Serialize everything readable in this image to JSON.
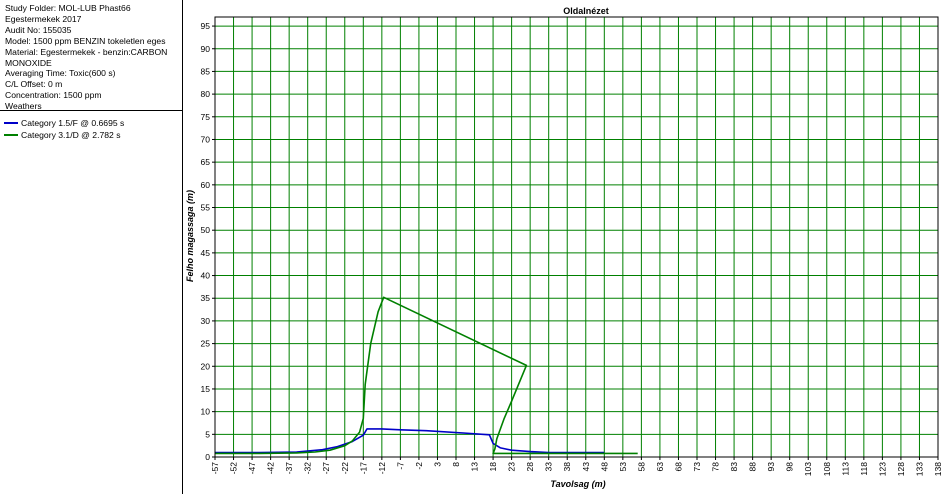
{
  "info": {
    "lines": [
      "Study Folder: MOL-LUB Phast66",
      "Egestermekek 2017",
      "Audit No: 155035",
      "Model: 1500 ppm BENZIN tokeletlen eges",
      "Material: Egestermekek - benzin:CARBON",
      "MONOXIDE",
      "Averaging Time: Toxic(600 s)",
      "C/L Offset: 0 m",
      "Concentration: 1500 ppm",
      "Weathers"
    ]
  },
  "colors": {
    "grid": "#008000",
    "series1": "#0000c8",
    "series2": "#008000",
    "axis": "#000000"
  },
  "chart_data": {
    "type": "line",
    "title": "Oldalnézet",
    "xlabel": "Tavolsag (m)",
    "ylabel": "Felho magassaga (m)",
    "xlim": [
      -57,
      138
    ],
    "ylim": [
      0,
      97
    ],
    "x_ticks": [
      "-57",
      "-52",
      "-47",
      "-42",
      "-37",
      "-32",
      "-27",
      "-22",
      "-17",
      "-12",
      "-7",
      "-2",
      "3",
      "8",
      "13",
      "18",
      "23",
      "28",
      "33",
      "38",
      "43",
      "48",
      "53",
      "58",
      "63",
      "68",
      "73",
      "78",
      "83",
      "88",
      "93",
      "98",
      "103",
      "108",
      "113",
      "118",
      "123",
      "128",
      "133",
      "138"
    ],
    "y_ticks": [
      "0",
      "5",
      "10",
      "15",
      "20",
      "25",
      "30",
      "35",
      "40",
      "45",
      "50",
      "55",
      "60",
      "65",
      "70",
      "75",
      "80",
      "85",
      "90",
      "95"
    ],
    "grid": true,
    "legend": "left-panel",
    "series": [
      {
        "name": "Category 1.5/F @ 0.6695 s",
        "color": "#0000c8",
        "points": [
          [
            -57,
            1
          ],
          [
            -45,
            1
          ],
          [
            -35,
            1.1
          ],
          [
            -28,
            1.6
          ],
          [
            -24,
            2.3
          ],
          [
            -20,
            3.4
          ],
          [
            -17,
            4.8
          ],
          [
            -16,
            6.2
          ],
          [
            -12,
            6.2
          ],
          [
            -7,
            6
          ],
          [
            0,
            5.8
          ],
          [
            10,
            5.3
          ],
          [
            17,
            4.9
          ],
          [
            18,
            3
          ],
          [
            20,
            2
          ],
          [
            23,
            1.5
          ],
          [
            28,
            1.2
          ],
          [
            33,
            1
          ],
          [
            43,
            1
          ],
          [
            48,
            1
          ]
        ]
      },
      {
        "name": "Category 3.1/D @ 2.782 s",
        "color": "#008000",
        "points": [
          [
            -57,
            0.8
          ],
          [
            -45,
            0.8
          ],
          [
            -35,
            0.9
          ],
          [
            -30,
            1.1
          ],
          [
            -26,
            1.5
          ],
          [
            -22,
            2.5
          ],
          [
            -20,
            3.5
          ],
          [
            -18,
            5.5
          ],
          [
            -17,
            8.5
          ],
          [
            -16.5,
            16
          ],
          [
            -15,
            25
          ],
          [
            -13,
            32
          ],
          [
            -11.5,
            35.2
          ],
          [
            27,
            20.2
          ],
          [
            23,
            12.3
          ],
          [
            21,
            8.5
          ],
          [
            19,
            4
          ],
          [
            18.5,
            1.8
          ],
          [
            18,
            0.8
          ],
          [
            57,
            0.8
          ]
        ]
      }
    ]
  }
}
